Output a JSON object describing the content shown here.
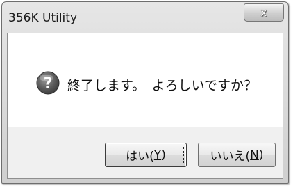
{
  "window": {
    "title": "356K Utility",
    "close_glyph": "x"
  },
  "dialog": {
    "icon": "question-icon",
    "message": "終了します。　よろしいですか？"
  },
  "buttons": {
    "yes": {
      "prefix": "はい(",
      "accel": "Y",
      "suffix": ")"
    },
    "no": {
      "prefix": "いいえ(",
      "accel": "N",
      "suffix": ")"
    }
  },
  "colors": {
    "icon_gray": "#5a5a5a",
    "client_bg": "#ffffff",
    "button_area_bg": "#f0f0f0"
  }
}
